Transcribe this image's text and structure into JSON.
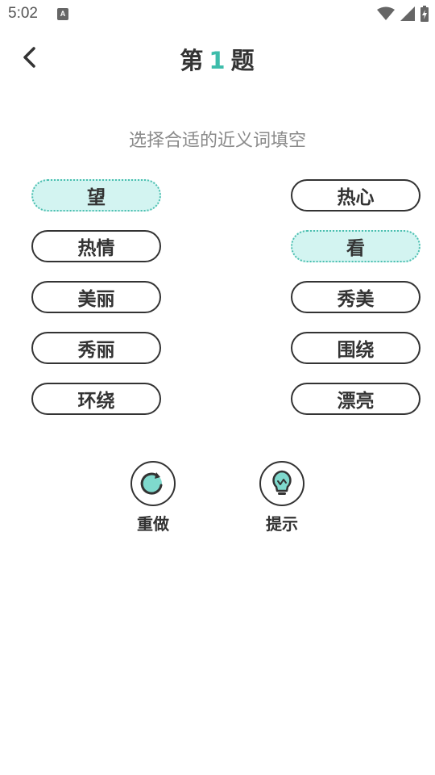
{
  "status_bar": {
    "time": "5:02",
    "notification_glyph": "A",
    "icons": [
      "wifi-icon",
      "cell-signal-icon",
      "battery-charging-icon"
    ]
  },
  "header": {
    "title_prefix": "第",
    "title_number": "1",
    "title_suffix": "题",
    "number_color": "#3dbcaa"
  },
  "instruction": "选择合适的近义词填空",
  "options": {
    "left": [
      {
        "label": "望",
        "selected": true
      },
      {
        "label": "热情",
        "selected": false
      },
      {
        "label": "美丽",
        "selected": false
      },
      {
        "label": "秀丽",
        "selected": false
      },
      {
        "label": "环绕",
        "selected": false
      }
    ],
    "right": [
      {
        "label": "热心",
        "selected": false
      },
      {
        "label": "看",
        "selected": true
      },
      {
        "label": "秀美",
        "selected": false
      },
      {
        "label": "围绕",
        "selected": false
      },
      {
        "label": "漂亮",
        "selected": false
      }
    ]
  },
  "actions": {
    "redo_label": "重做",
    "hint_label": "提示"
  },
  "colors": {
    "accent": "#3dbcaa",
    "selected_fill": "#d3f4f1",
    "selected_border": "#4bbfb0",
    "text_dark": "#333333",
    "text_muted": "#8a8a8a"
  }
}
